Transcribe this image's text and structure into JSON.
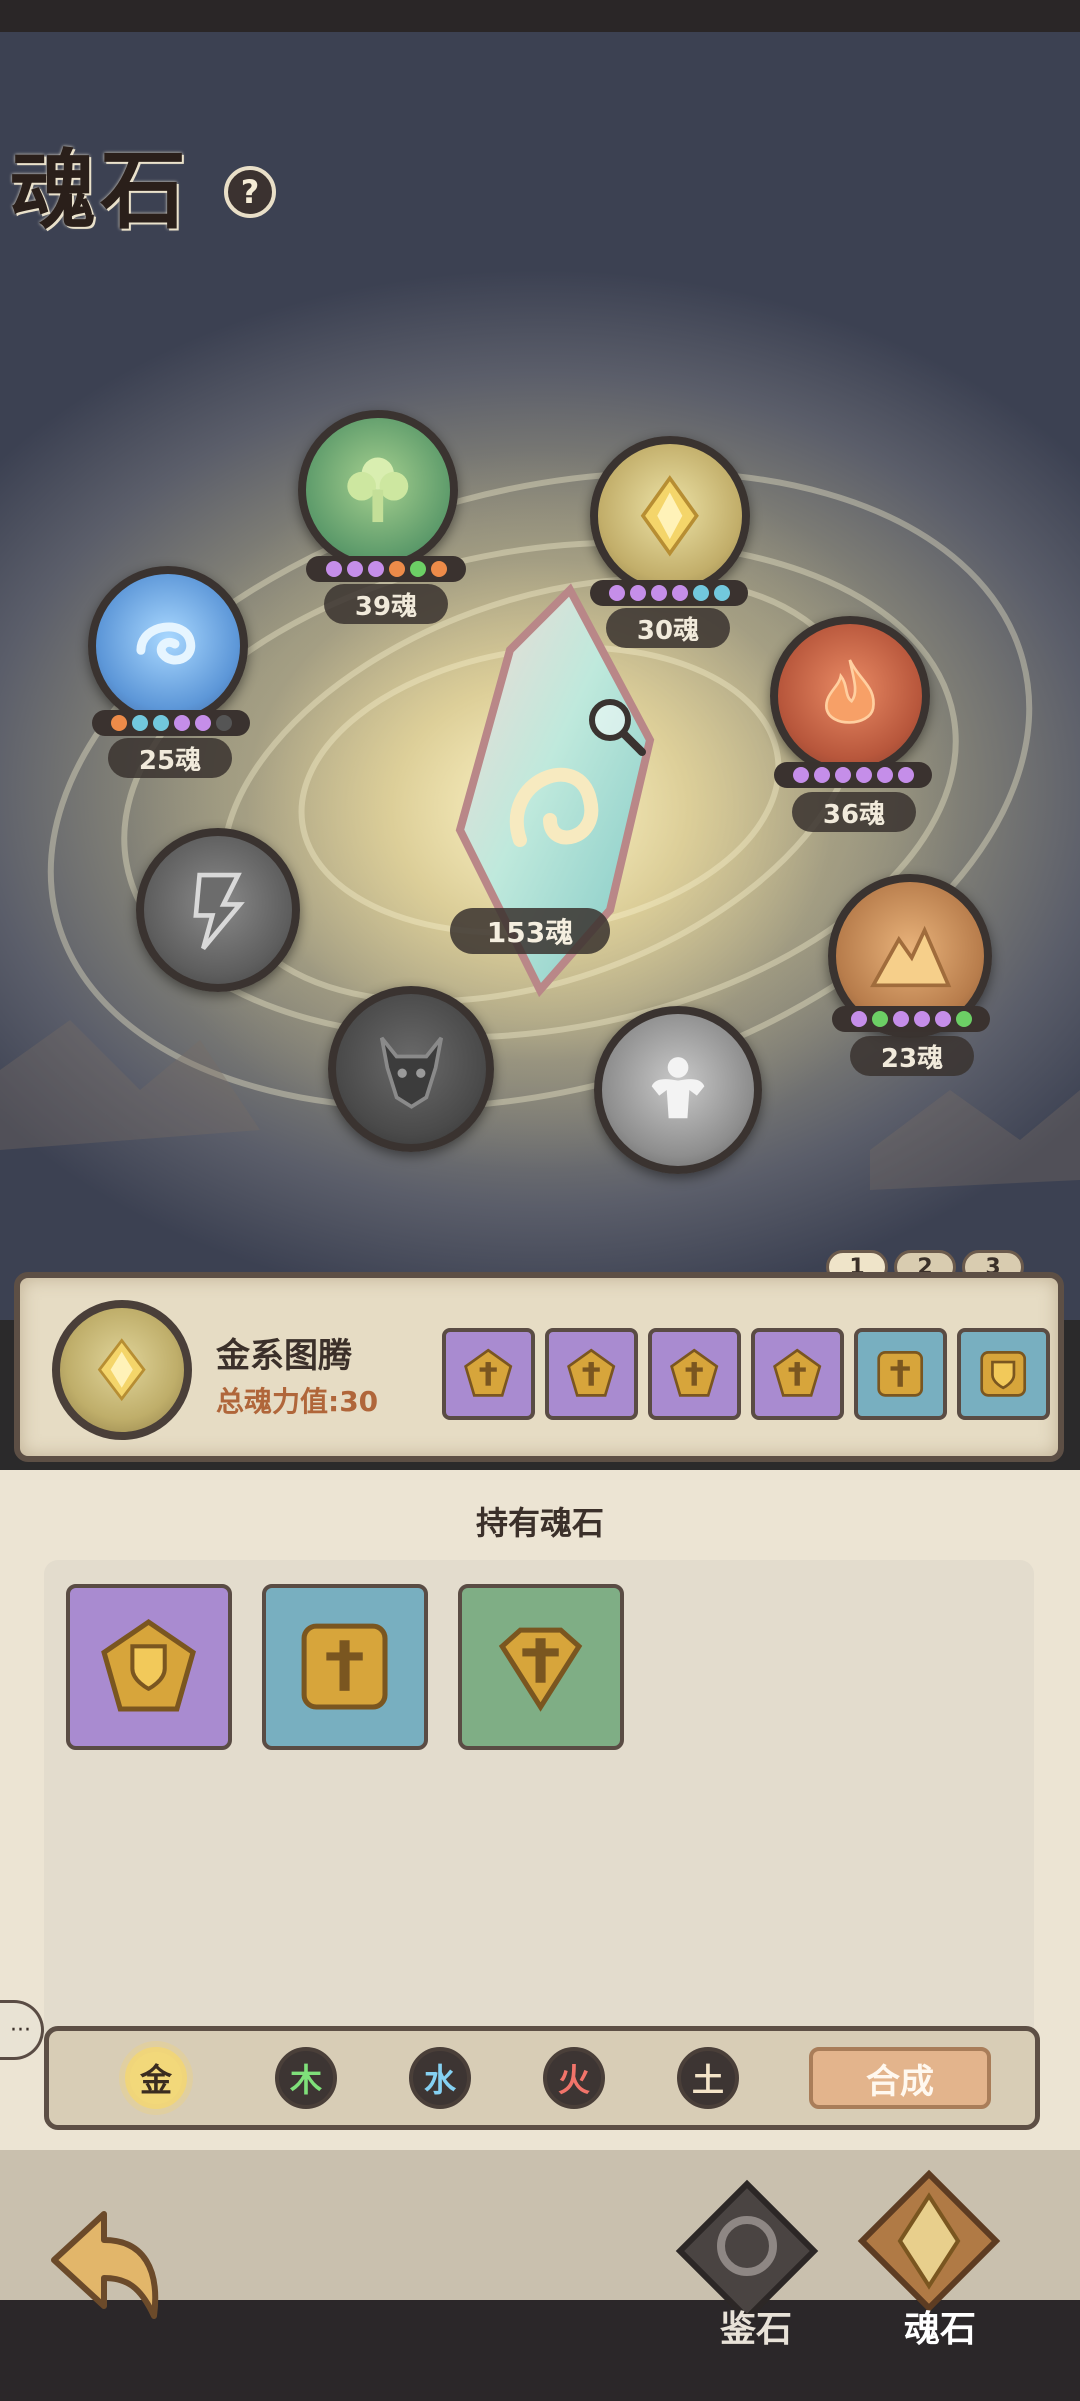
{
  "page": {
    "title": "魂石",
    "help_label": "?"
  },
  "crystal": {
    "soul_label": "153魂"
  },
  "totems": [
    {
      "id": "wood",
      "soul_label": "39魂",
      "dots": [
        "#c58ee9",
        "#c58ee9",
        "#c58ee9",
        "#ed8b49",
        "#6ccf65",
        "#ed8b49"
      ]
    },
    {
      "id": "metal",
      "soul_label": "30魂",
      "dots": [
        "#c58ee9",
        "#c58ee9",
        "#c58ee9",
        "#c58ee9",
        "#72c8dd",
        "#72c8dd"
      ]
    },
    {
      "id": "water",
      "soul_label": "25魂",
      "dots": [
        "#ed8b49",
        "#72c8dd",
        "#72c8dd",
        "#c58ee9",
        "#c58ee9",
        "#555555"
      ]
    },
    {
      "id": "fire",
      "soul_label": "36魂",
      "dots": [
        "#c58ee9",
        "#c58ee9",
        "#c58ee9",
        "#c58ee9",
        "#c58ee9",
        "#c58ee9"
      ]
    },
    {
      "id": "earth",
      "soul_label": "23魂",
      "dots": [
        "#c58ee9",
        "#6ccf65",
        "#c58ee9",
        "#c58ee9",
        "#c58ee9",
        "#6ccf65"
      ]
    }
  ],
  "locked_icons": [
    "lightning-icon",
    "demon-mask-icon",
    "strongman-icon"
  ],
  "tabs": [
    "1",
    "2",
    "3"
  ],
  "selected_totem": {
    "name": "金系图腾",
    "total": "总魂力值:30",
    "slots": [
      {
        "color": "#a98bd0",
        "icon": "pentagon-sword-icon"
      },
      {
        "color": "#a98bd0",
        "icon": "pentagon-sword-icon"
      },
      {
        "color": "#a98bd0",
        "icon": "pentagon-sword-icon"
      },
      {
        "color": "#a98bd0",
        "icon": "pentagon-sword-icon"
      },
      {
        "color": "#78afc0",
        "icon": "square-sword-icon"
      },
      {
        "color": "#78afc0",
        "icon": "square-shield-icon"
      }
    ]
  },
  "owned": {
    "title": "持有魂石",
    "items": [
      {
        "color": "#a98bd0",
        "icon": "pentagon-shield-icon"
      },
      {
        "color": "#78afc0",
        "icon": "square-sword-icon"
      },
      {
        "color": "#7fae85",
        "icon": "gem-sword-icon"
      }
    ]
  },
  "element_filters": [
    {
      "label": "金",
      "color": "#3a2c20",
      "active": true
    },
    {
      "label": "木",
      "color": "#7fe07a",
      "active": false
    },
    {
      "label": "水",
      "color": "#85d1f2",
      "active": false
    },
    {
      "label": "火",
      "color": "#f2746a",
      "active": false
    },
    {
      "label": "土",
      "color": "#f4e4c8",
      "active": false
    }
  ],
  "compose_label": "合成",
  "chat_label": "···",
  "nav": {
    "appraise_label": "鉴石",
    "soulstone_label": "魂石"
  }
}
